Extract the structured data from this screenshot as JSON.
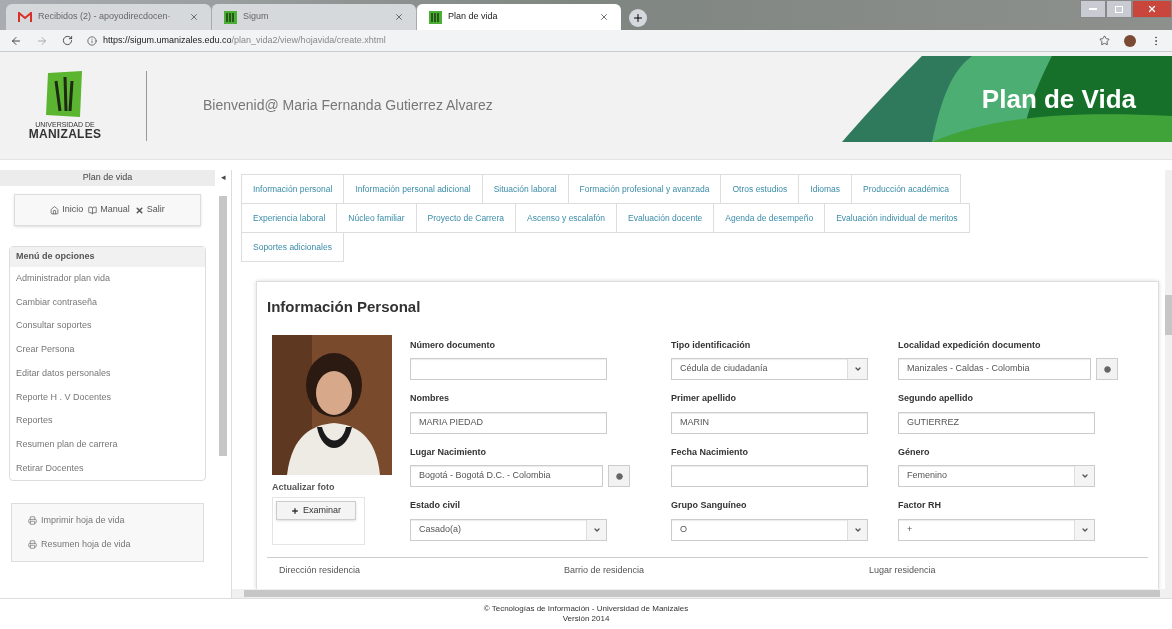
{
  "browser": {
    "tabs": [
      {
        "title": "Recibidos (2) - apoyodirecdocen·",
        "kind": "mail",
        "selected": false
      },
      {
        "title": "Sigum",
        "kind": "site",
        "selected": false
      },
      {
        "title": "Plan de vida",
        "kind": "site",
        "selected": true
      }
    ],
    "url": {
      "host": "https://sigum.umanizales.edu.co",
      "path": "/plan_vida2/view/hojavida/create.xhtml"
    }
  },
  "header": {
    "logo_lines": [
      "UNIVERSIDAD DE",
      "MANIZALES"
    ],
    "welcome": "Bienvenid@ Maria Fernanda Gutierrez Alvarez",
    "banner": "Plan de Vida"
  },
  "sidebar": {
    "title": "Plan de vida",
    "collapse": "◂",
    "quick_links": [
      {
        "kind": "home",
        "label": "Inicio"
      },
      {
        "kind": "manual",
        "label": "Manual"
      },
      {
        "kind": "exit",
        "label": "Salir"
      }
    ],
    "menu_title": "Menú de opciones",
    "menu": [
      "Administrador plan vida",
      "Cambiar contraseña",
      "Consultar soportes",
      "Crear Persona",
      "Editar datos personales",
      "Reporte H . V Docentes",
      "Reportes",
      "Resumen plan de carrera",
      "Retirar Docentes"
    ],
    "print_links": [
      "Imprimir hoja de vida",
      "Resumen hoja de vida"
    ]
  },
  "tabs": [
    [
      "Información personal",
      "Información personal adicional",
      "Situación laboral",
      "Formación profesional y avanzada",
      "Otros estudios",
      "Idiomas",
      "Producción académica"
    ],
    [
      "Experiencia laboral",
      "Núcleo familiar",
      "Proyecto de Carrera",
      "Ascenso y escalafón",
      "Evaluación docente",
      "Agenda de desempeño",
      "Evaluación individual de meritos"
    ],
    [
      "Soportes adicionales"
    ]
  ],
  "form": {
    "title": "Información Personal",
    "photo_label": "Actualizar foto",
    "browse_button": "Examinar",
    "rows": [
      [
        {
          "label": "Número documento",
          "kind": "text"
        },
        {
          "label": "Tipo identificación",
          "kind": "select",
          "value": "Cédula de ciudadanía"
        },
        {
          "label": "Localidad expedición documento",
          "kind": "lookup",
          "value": "Manizales - Caldas - Colombia"
        }
      ],
      [
        {
          "label": "Nombres",
          "kind": "text",
          "value": "MARIA PIEDAD"
        },
        {
          "label": "Primer apellido",
          "kind": "text",
          "value": "MARIN"
        },
        {
          "label": "Segundo apellido",
          "kind": "text",
          "value": "GUTIERREZ"
        }
      ],
      [
        {
          "label": "Lugar Nacimiento",
          "kind": "lookup",
          "value": "Bogotá - Bogotá D.C. - Colombia"
        },
        {
          "label": "Fecha Nacimiento",
          "kind": "text"
        },
        {
          "label": "Género",
          "kind": "select",
          "value": "Femenino"
        }
      ],
      [
        {
          "label": "Estado civil",
          "kind": "select",
          "value": "Casado(a)"
        },
        {
          "label": "Grupo Sanguíneo",
          "kind": "select",
          "value": "O"
        },
        {
          "label": "Factor RH",
          "kind": "select",
          "value": "+"
        }
      ]
    ],
    "next_labels": [
      "Dirección residencia",
      "Barrio de residencia",
      "Lugar residencia"
    ]
  },
  "footer": [
    "© Tecnologías de Información - Universidad de Manizales",
    "Versión 2014"
  ]
}
